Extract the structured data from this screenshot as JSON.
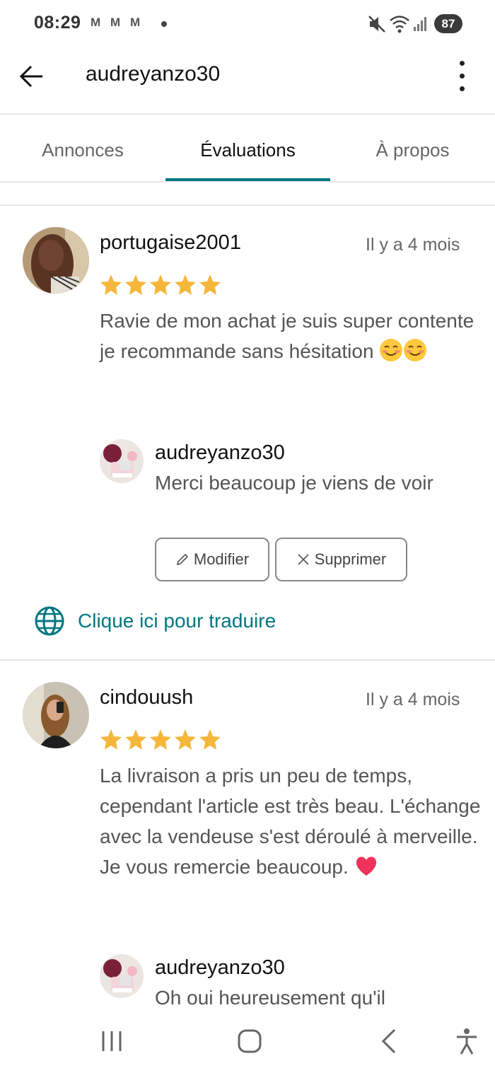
{
  "status_bar": {
    "time": "08:29",
    "mail_icons": [
      "M",
      "M",
      "M"
    ],
    "battery": "87",
    "icons": [
      "mute-icon",
      "wifi-icon",
      "signal-icon",
      "battery-icon"
    ]
  },
  "app_bar": {
    "title": "audreyanzo30",
    "icons": [
      "arrow-left-icon",
      "more-vertical-icon"
    ]
  },
  "tabs": [
    {
      "label": "Annonces",
      "active": false
    },
    {
      "label": "Évaluations",
      "active": true
    },
    {
      "label": "À propos",
      "active": false
    }
  ],
  "accent_color": "#007782",
  "star_color": "#F5B63A",
  "reviews": [
    {
      "username": "portugaise2001",
      "time": "Il y a 4 mois",
      "rating": 5,
      "text": "Ravie de mon achat je suis super contente je recommande sans hésitation",
      "emojis": [
        "smiling-face-emoji",
        "smiling-face-emoji"
      ],
      "reply": {
        "username": "audreyanzo30",
        "text": "Merci beaucoup je viens de voir",
        "edit_label": "Modifier",
        "delete_label": "Supprimer"
      },
      "translate_label": "Clique ici pour traduire"
    },
    {
      "username": "cindouush",
      "time": "Il y a 4 mois",
      "rating": 5,
      "text": "La livraison a pris un peu de temps, cependant l'article est très beau. L'échange avec la vendeuse s'est déroulé à merveille. Je vous remercie beaucoup.",
      "emojis": [
        "red-heart-emoji"
      ],
      "reply": {
        "username": "audreyanzo30",
        "text": "Oh oui heureusement qu'il"
      }
    }
  ],
  "nav_bar": {
    "icons": [
      "recent-apps-icon",
      "home-icon",
      "back-icon",
      "accessibility-icon"
    ]
  }
}
